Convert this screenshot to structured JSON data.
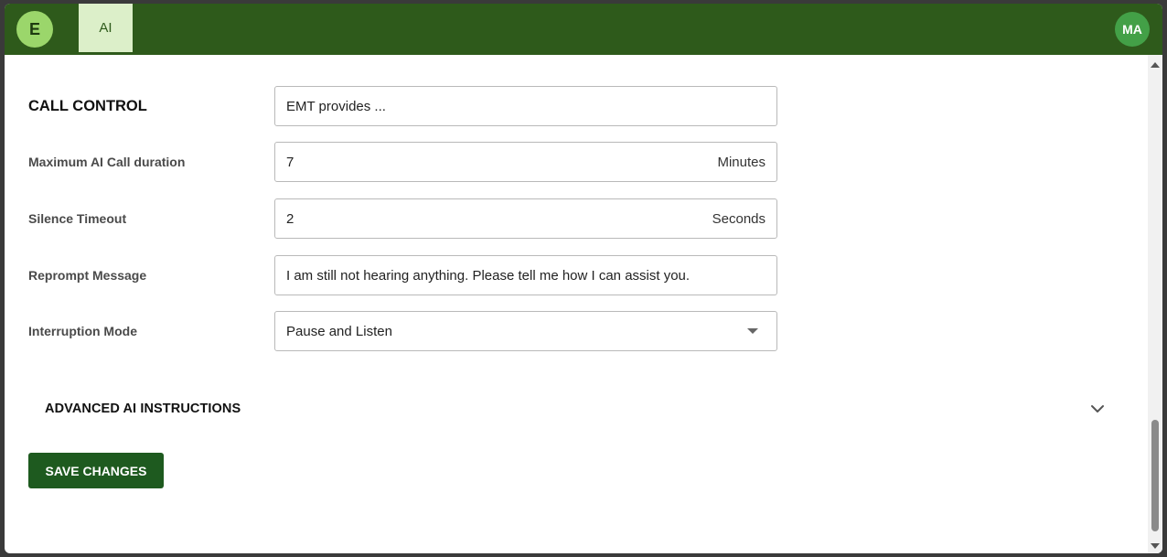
{
  "header": {
    "app_avatar": "E",
    "active_tab": "AI",
    "user_avatar": "MA"
  },
  "form": {
    "section_title": "CALL CONTROL",
    "call_control_value": "EMT provides ...",
    "max_duration": {
      "label": "Maximum AI Call duration",
      "value": "7",
      "unit": "Minutes"
    },
    "silence_timeout": {
      "label": "Silence Timeout",
      "value": "2",
      "unit": "Seconds"
    },
    "reprompt": {
      "label": "Reprompt Message",
      "value": "I am still not hearing anything. Please tell me how I can assist you."
    },
    "interruption": {
      "label": "Interruption Mode",
      "value": "Pause and Listen"
    }
  },
  "advanced": {
    "title": "ADVANCED AI INSTRUCTIONS",
    "icon": "chevron-down-icon"
  },
  "actions": {
    "save_label": "SAVE CHANGES"
  },
  "colors": {
    "header_bg": "#2e5a1b",
    "tab_active_bg": "#dcefc9",
    "save_bg": "#1e5a1f",
    "user_avatar_bg": "#43a047"
  }
}
